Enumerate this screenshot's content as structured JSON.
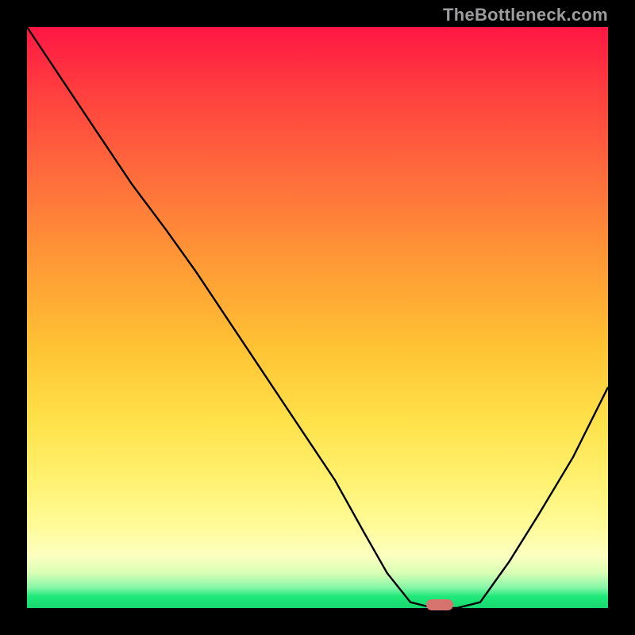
{
  "watermark": "TheBottleneck.com",
  "colors": {
    "frame": "#000000",
    "curve": "#000000",
    "marker": "#d6736f",
    "gradient_top": "#ff1744",
    "gradient_bottom": "#18d96f"
  },
  "chart_data": {
    "type": "line",
    "title": "",
    "xlabel": "",
    "ylabel": "",
    "xlim": [
      0,
      100
    ],
    "ylim": [
      0,
      100
    ],
    "grid": false,
    "series": [
      {
        "name": "bottleneck-curve",
        "x": [
          0,
          6,
          12,
          18,
          24,
          29,
          35,
          41,
          47,
          53,
          58,
          62,
          66,
          70,
          74,
          78,
          83,
          88,
          94,
          100
        ],
        "y": [
          100,
          91,
          82,
          73,
          65,
          58,
          49,
          40,
          31,
          22,
          13,
          6,
          1,
          0,
          0,
          1,
          8,
          16,
          26,
          38
        ]
      }
    ],
    "annotations": [
      {
        "name": "optimal-marker",
        "x": 71,
        "y": 0.5
      }
    ]
  }
}
